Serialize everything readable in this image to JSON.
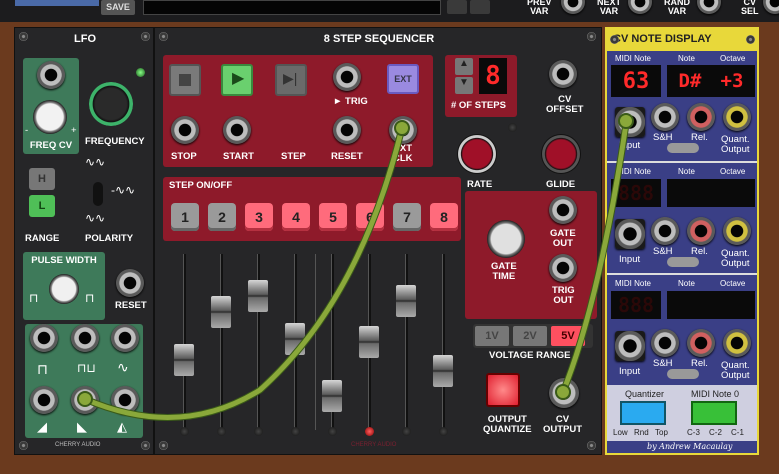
{
  "topbar": {
    "save_label": "SAVE",
    "labels": [
      "PREV\nVAR",
      "NEXT\nVAR",
      "RAND\nVAR",
      "CV\nSEL"
    ]
  },
  "lfo": {
    "title": "LFO",
    "freq_cv": "FREQ CV",
    "frequency": "FREQUENCY",
    "range": "RANGE",
    "polarity": "POLARITY",
    "range_h": "H",
    "range_l": "L",
    "pulse_width": "PULSE WIDTH",
    "reset": "RESET",
    "brand": "CHERRY AUDIO",
    "minus": "-",
    "plus": "+"
  },
  "seq": {
    "title": "8 STEP SEQUENCER",
    "stop": "STOP",
    "start": "START",
    "step": "STEP",
    "trig": "► TRIG",
    "reset": "RESET",
    "ext": "EXT",
    "ext_clk": "EXT\nCLK",
    "num_steps_label": "# OF STEPS",
    "num_steps": "8",
    "cv_offset": "CV\nOFFSET",
    "rate": "RATE",
    "glide": "GLIDE",
    "step_onoff": "STEP ON/OFF",
    "steps": [
      "1",
      "2",
      "3",
      "4",
      "5",
      "6",
      "7",
      "8"
    ],
    "gate_time": "GATE\nTIME",
    "gate_out": "GATE\nOUT",
    "trig_out": "TRIG\nOUT",
    "v1": "1V",
    "v2": "2V",
    "v5": "5V",
    "voltage_range": "VOLTAGE RANGE",
    "output_quantize": "OUTPUT\nQUANTIZE",
    "cv_output": "CV\nOUTPUT",
    "brand": "CHERRY AUDIO"
  },
  "cv": {
    "title": "CV NOTE DISPLAY",
    "midi_note": "MIDI Note",
    "note": "Note",
    "octave": "Octave",
    "row1_midi": "63",
    "row1_note": "D#",
    "row1_octave": "+3",
    "blank_digits": "888",
    "input": "Input",
    "sh": "S&H",
    "rel": "Rel.",
    "quant": "Quant.\nOutput",
    "quantizer": "Quantizer",
    "midi_note0": "MIDI Note 0",
    "low": "Low",
    "rnd": "Rnd",
    "top": "Top",
    "c3": "C-3",
    "c2": "C-2",
    "c1": "C-1",
    "author": "by Andrew Macaulay"
  },
  "colors": {
    "cable": "#8aa83a",
    "red": "#8e1a2a",
    "green": "#3e7a5a",
    "blue": "#3a3f86",
    "accent_yellow": "#e8d83a"
  }
}
